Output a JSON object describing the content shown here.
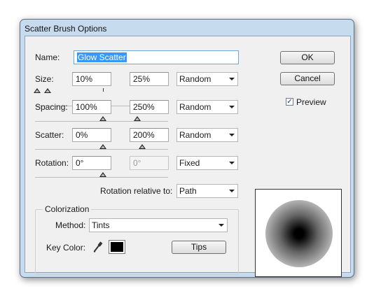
{
  "window": {
    "title": "Scatter Brush Options"
  },
  "name": {
    "label": "Name:",
    "value": "Glow Scatter"
  },
  "size": {
    "label": "Size:",
    "min": "10%",
    "max": "25%",
    "variation": "Random"
  },
  "spacing": {
    "label": "Spacing:",
    "min": "100%",
    "max": "250%",
    "variation": "Random"
  },
  "scatter": {
    "label": "Scatter:",
    "min": "0%",
    "max": "200%",
    "variation": "Random"
  },
  "rotation": {
    "label": "Rotation:",
    "min": "0°",
    "max": "0°",
    "variation": "Fixed"
  },
  "rotation_relative": {
    "label": "Rotation relative to:",
    "value": "Path"
  },
  "colorization": {
    "group_label": "Colorization",
    "method_label": "Method:",
    "method_value": "Tints",
    "key_color_label": "Key Color:",
    "key_color": "#000000",
    "tips_label": "Tips"
  },
  "buttons": {
    "ok": "OK",
    "cancel": "Cancel"
  },
  "preview": {
    "label": "Preview",
    "checked": true,
    "check_glyph": "✓"
  },
  "icons": {
    "eyedropper": "eyedropper-icon",
    "dropdown": "chevron-down-icon"
  }
}
